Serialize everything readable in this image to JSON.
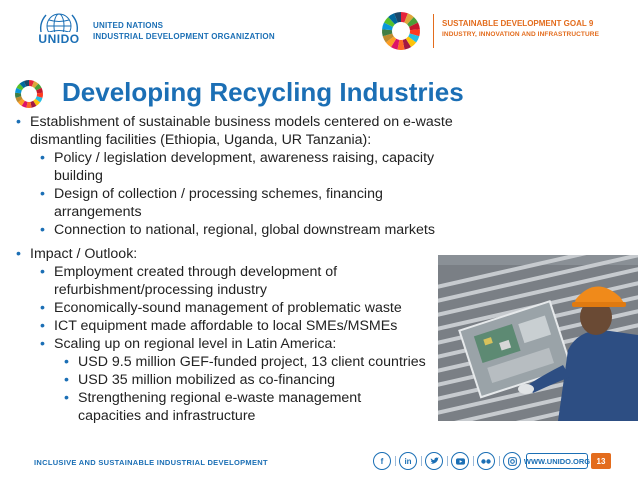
{
  "header": {
    "org_line1": "UNITED NATIONS",
    "org_line2": "INDUSTRIAL DEVELOPMENT ORGANIZATION",
    "logo_text": "UNIDO",
    "sdg_title": "SUSTAINABLE DEVELOPMENT GOAL 9",
    "sdg_subtitle": "INDUSTRY, INNOVATION AND INFRASTRUCTURE",
    "accent_color": "#e36c1d",
    "brand_color": "#1b6fb5"
  },
  "slide": {
    "title": "Developing Recycling Industries",
    "bullets": [
      "Establishment of sustainable business models centered on e-waste dismantling facilities (Ethiopia, Uganda, UR Tanzania):",
      "Policy / legislation development, awareness raising, capacity building",
      "Design of collection / processing schemes, financing arrangements",
      "Connection to national, regional, global downstream markets",
      "Impact / Outlook:",
      "Employment created through development of refurbishment/processing industry",
      "Economically-sound management of problematic waste",
      "ICT equipment made affordable to local SMEs/MSMEs",
      "Scaling up on regional level in Latin America:",
      "USD 9.5 million GEF-funded project, 13 client countries",
      "USD 35 million mobilized as co-financing",
      "Strengthening regional e-waste management capacities and infrastructure"
    ]
  },
  "footer": {
    "tagline": "INCLUSIVE AND SUSTAINABLE INDUSTRIAL DEVELOPMENT",
    "social": [
      "facebook-icon",
      "linkedin-icon",
      "twitter-icon",
      "youtube-icon",
      "flickr-icon",
      "instagram-icon"
    ],
    "website": "WWW.UNIDO.ORG",
    "page_number": "13"
  }
}
